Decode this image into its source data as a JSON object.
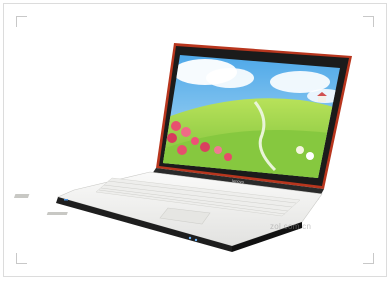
{
  "photo": {
    "subject": "laptop",
    "brand_text": "lenovo",
    "bezel_color": "#b8361e",
    "keyboard_color": "#f3f3f1",
    "watermark_text": "zol.com.cn"
  }
}
